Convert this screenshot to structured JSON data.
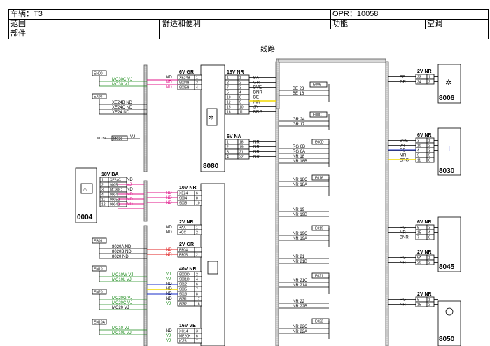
{
  "header": {
    "vehicle_label": "车辆：T3",
    "opr_label": "OPR：10058",
    "scope_label": "范围",
    "scope_value": "舒适和便利",
    "function_label": "功能",
    "function_value": "空调",
    "part_label": "部件"
  },
  "subtitle": "线路",
  "modules": {
    "m8080": "8080",
    "m0004": "0004",
    "m8006": "8006",
    "m8030": "8030",
    "m8045": "8045",
    "m8050": "8050"
  },
  "left_grounds": {
    "e1": {
      "code": "EN00",
      "lines": [
        "MC30C VJ",
        "MC30 VJ"
      ]
    },
    "e2": {
      "code": "EX00",
      "lines": [
        "XE24B ND",
        "XE24C ND",
        "XE24 ND"
      ]
    },
    "e3": {
      "code": "MC30",
      "label": "MC30",
      "suffix": "VJ"
    },
    "e4": {
      "code": "EB06",
      "lines": [
        "8020A ND",
        "8020B ND",
        "8020 ND"
      ]
    },
    "e5": {
      "code": "EN10",
      "lines": [
        "MC10W VJ",
        "MC10L VJ"
      ]
    },
    "e6": {
      "code": "EN20",
      "lines": [
        "MC20G VJ",
        "MC20C VJ",
        "MC20 VJ"
      ]
    },
    "e7": {
      "code": "EN10A",
      "lines": [
        "MC10 VJ",
        "MC10L VJ"
      ]
    }
  },
  "connectors": {
    "c6vgr": {
      "title": "6V GR",
      "pins": [
        [
          "XE24B",
          "1"
        ],
        [
          "9004B",
          "3"
        ],
        [
          "9005B",
          "4"
        ]
      ],
      "side": [
        "ND",
        "ND",
        "ND"
      ]
    },
    "c18vnr": {
      "title": "18V NR",
      "pins": [
        [
          "1",
          "1"
        ],
        [
          "2",
          "2"
        ],
        [
          "7",
          "3"
        ],
        [
          "5",
          "4"
        ],
        [
          "10",
          "8"
        ],
        [
          "12",
          "9"
        ],
        [
          "15",
          "10"
        ],
        [
          "18",
          "11"
        ]
      ],
      "wires": [
        "BA",
        "GR",
        "BVE",
        "BNR",
        "BE",
        "MR",
        "JN",
        "BRG"
      ]
    },
    "c6vna": {
      "title": "6V NA",
      "pins": [
        [
          "1",
          "18"
        ],
        [
          "2",
          "19"
        ],
        [
          "3",
          "21"
        ],
        [
          "4",
          "22"
        ]
      ],
      "wires": [
        "NR",
        "NR",
        "NR",
        "NR"
      ]
    },
    "c18vba": {
      "title": "18V BA",
      "pins": [
        [
          "1",
          "XE24C"
        ],
        [
          "2",
          "9005"
        ],
        [
          "3",
          "MC30C"
        ],
        [
          "4",
          "9004"
        ],
        [
          "11",
          "9005B"
        ],
        [
          "12",
          "9004B"
        ]
      ],
      "side": [
        "ND",
        "VJ",
        "ND",
        "ND",
        "ND",
        "ND"
      ]
    },
    "c10vnr": {
      "title": "10V NR",
      "pins": [
        [
          "XE24",
          "6"
        ],
        [
          "9004",
          "8"
        ],
        [
          "9005",
          "10"
        ]
      ],
      "side": [
        "ND",
        "ND",
        "ND"
      ]
    },
    "c2vnr": {
      "title": "2V NR",
      "pins": [
        [
          "+AA",
          "1"
        ],
        [
          "+CC",
          "2"
        ]
      ],
      "side": [
        "ND",
        "ND"
      ]
    },
    "c2vgr": {
      "title": "2V GR",
      "pins": [
        [
          "BF04",
          "1"
        ],
        [
          "BF05",
          "2"
        ]
      ],
      "side": [
        "ND",
        "NR"
      ]
    },
    "c40vnr": {
      "title": "40V NR",
      "pins": [
        [
          "9000D",
          "2"
        ],
        [
          "9001D",
          "4"
        ],
        [
          "9012",
          "6"
        ],
        [
          "9005",
          "7"
        ],
        [
          "9013",
          "8"
        ],
        [
          "8051",
          "17"
        ],
        [
          "8052",
          "18"
        ]
      ],
      "side": [
        "VJ",
        "VJ",
        "ND",
        "ND",
        "ND",
        "ND",
        "VJ"
      ]
    },
    "c16vve": {
      "title": "16V VE",
      "pins": [
        [
          "XC14",
          "3"
        ],
        [
          "ME20K",
          "6"
        ],
        [
          "IC28",
          "7"
        ]
      ],
      "side": [
        "ND",
        "VJ",
        "VJ"
      ]
    }
  },
  "harness_right": {
    "labels": [
      [
        "BE 23",
        "BE 16"
      ],
      [
        "GR 24",
        "GR 17"
      ],
      [
        "RG 6B",
        "RG 6A",
        "NR 18",
        "NR 18B"
      ],
      [
        "NR 18C",
        "NR 18A"
      ],
      [
        "NR 19",
        "NR 19B"
      ],
      [
        "NR 19C",
        "NR 19A"
      ],
      [
        "NR 21",
        "NR 21B"
      ],
      [
        "NR 21C",
        "NR 21A"
      ],
      [
        "NR 22",
        "NR 22B"
      ],
      [
        "NR 22C",
        "NR 22A"
      ]
    ],
    "boxes": [
      "E006",
      "E00C",
      "E00D",
      "E016",
      "E019",
      "E021",
      "E022"
    ]
  },
  "right_connectors": {
    "r2vnr_a": {
      "title": "2V NR",
      "pins": [
        [
          "23",
          "1"
        ],
        [
          "24",
          "2"
        ]
      ],
      "wires": [
        "BE",
        "GR"
      ]
    },
    "r6vnr": {
      "title": "6V NR",
      "pins": [
        [
          "3",
          "1"
        ],
        [
          "10",
          "2"
        ],
        [
          "4",
          "3"
        ],
        [
          "9",
          "5"
        ],
        [
          "11",
          "6"
        ]
      ],
      "wires": [
        "BVE",
        "JN",
        "RS",
        "MR",
        "BRG"
      ]
    },
    "r6vnr_b": {
      "title": "6V NR",
      "pins": [
        [
          "8",
          "3"
        ],
        [
          "15",
          "4"
        ],
        [
          "7",
          "6"
        ]
      ],
      "wires": [
        "RG",
        "NR",
        "BNR"
      ]
    },
    "r2vnr_b": {
      "title": "2V NR",
      "pins": [
        [
          "6A",
          "1"
        ],
        [
          "20",
          "2"
        ]
      ],
      "wires": [
        "RG",
        "NR"
      ]
    },
    "r2vnr_c": {
      "title": "2V NR",
      "pins": [
        [
          "5",
          "1"
        ],
        [
          "15",
          "2"
        ]
      ],
      "wires": [
        "RG",
        "NR"
      ]
    }
  },
  "colors": {
    "green": "#1a8a1a",
    "magenta": "#e0148a",
    "yellow": "#f2d800",
    "blue": "#1a2ec8",
    "red": "#e02020"
  }
}
